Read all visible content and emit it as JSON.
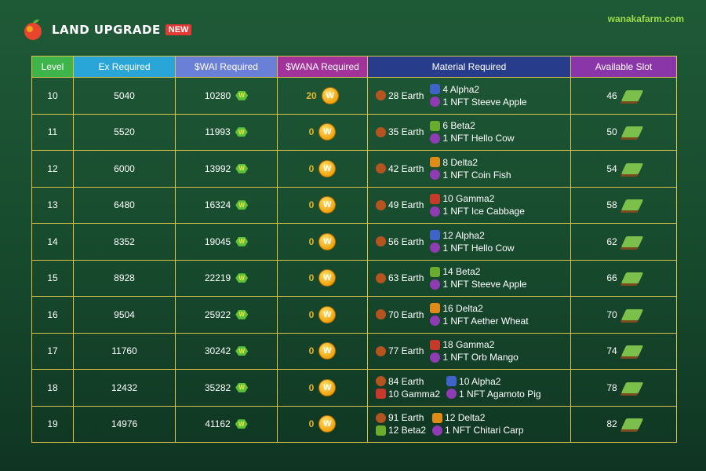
{
  "header": {
    "title": "Land Upgrade",
    "badge": "NEW",
    "site": "wanakafarm.com"
  },
  "columns": {
    "level": "Level",
    "ex": "Ex Required",
    "wai": "$WAI Required",
    "wana": "$WANA Required",
    "material": "Material Required",
    "slot": "Available Slot"
  },
  "rows": [
    {
      "level": "10",
      "ex": "5040",
      "wai": "10280",
      "wana": "20",
      "mat_left": [
        "28 Earth"
      ],
      "mat_right": [
        "4 Alpha2",
        "1 NFT Steeve Apple"
      ],
      "slot": "46"
    },
    {
      "level": "11",
      "ex": "5520",
      "wai": "11993",
      "wana": "0",
      "mat_left": [
        "35 Earth"
      ],
      "mat_right": [
        "6 Beta2",
        "1 NFT Hello Cow"
      ],
      "slot": "50"
    },
    {
      "level": "12",
      "ex": "6000",
      "wai": "13992",
      "wana": "0",
      "mat_left": [
        "42 Earth"
      ],
      "mat_right": [
        "8 Delta2",
        "1 NFT Coin Fish"
      ],
      "slot": "54"
    },
    {
      "level": "13",
      "ex": "6480",
      "wai": "16324",
      "wana": "0",
      "mat_left": [
        "49 Earth"
      ],
      "mat_right": [
        "10 Gamma2",
        "1 NFT Ice Cabbage"
      ],
      "slot": "58"
    },
    {
      "level": "14",
      "ex": "8352",
      "wai": "19045",
      "wana": "0",
      "mat_left": [
        "56 Earth"
      ],
      "mat_right": [
        "12 Alpha2",
        "1 NFT Hello Cow"
      ],
      "slot": "62"
    },
    {
      "level": "15",
      "ex": "8928",
      "wai": "22219",
      "wana": "0",
      "mat_left": [
        "63 Earth"
      ],
      "mat_right": [
        "14 Beta2",
        "1 NFT Steeve Apple"
      ],
      "slot": "66"
    },
    {
      "level": "16",
      "ex": "9504",
      "wai": "25922",
      "wana": "0",
      "mat_left": [
        "70 Earth"
      ],
      "mat_right": [
        "16 Delta2",
        "1 NFT Aether Wheat"
      ],
      "slot": "70"
    },
    {
      "level": "17",
      "ex": "11760",
      "wai": "30242",
      "wana": "0",
      "mat_left": [
        "77 Earth"
      ],
      "mat_right": [
        "18 Gamma2",
        "1 NFT Orb Mango"
      ],
      "slot": "74"
    },
    {
      "level": "18",
      "ex": "12432",
      "wai": "35282",
      "wana": "0",
      "mat_left": [
        "84 Earth",
        "10 Gamma2"
      ],
      "mat_right": [
        "10 Alpha2",
        "1 NFT Agamoto Pig"
      ],
      "slot": "78"
    },
    {
      "level": "19",
      "ex": "14976",
      "wai": "41162",
      "wana": "0",
      "mat_left": [
        "91 Earth",
        "12 Beta2"
      ],
      "mat_right": [
        "12 Delta2",
        "1 NFT Chitari Carp"
      ],
      "slot": "82"
    }
  ],
  "icons": {
    "logo": "apple-logo-icon",
    "wai": "wai-gem-icon",
    "wana": "wana-coin-icon",
    "slot": "land-tile-icon"
  },
  "colors": {
    "accent_green": "#3fb44a",
    "site_text": "#9bd94b",
    "new_badge": "#e53935",
    "grid": "#d9c24a",
    "wana_zero": "#e2b72a"
  }
}
